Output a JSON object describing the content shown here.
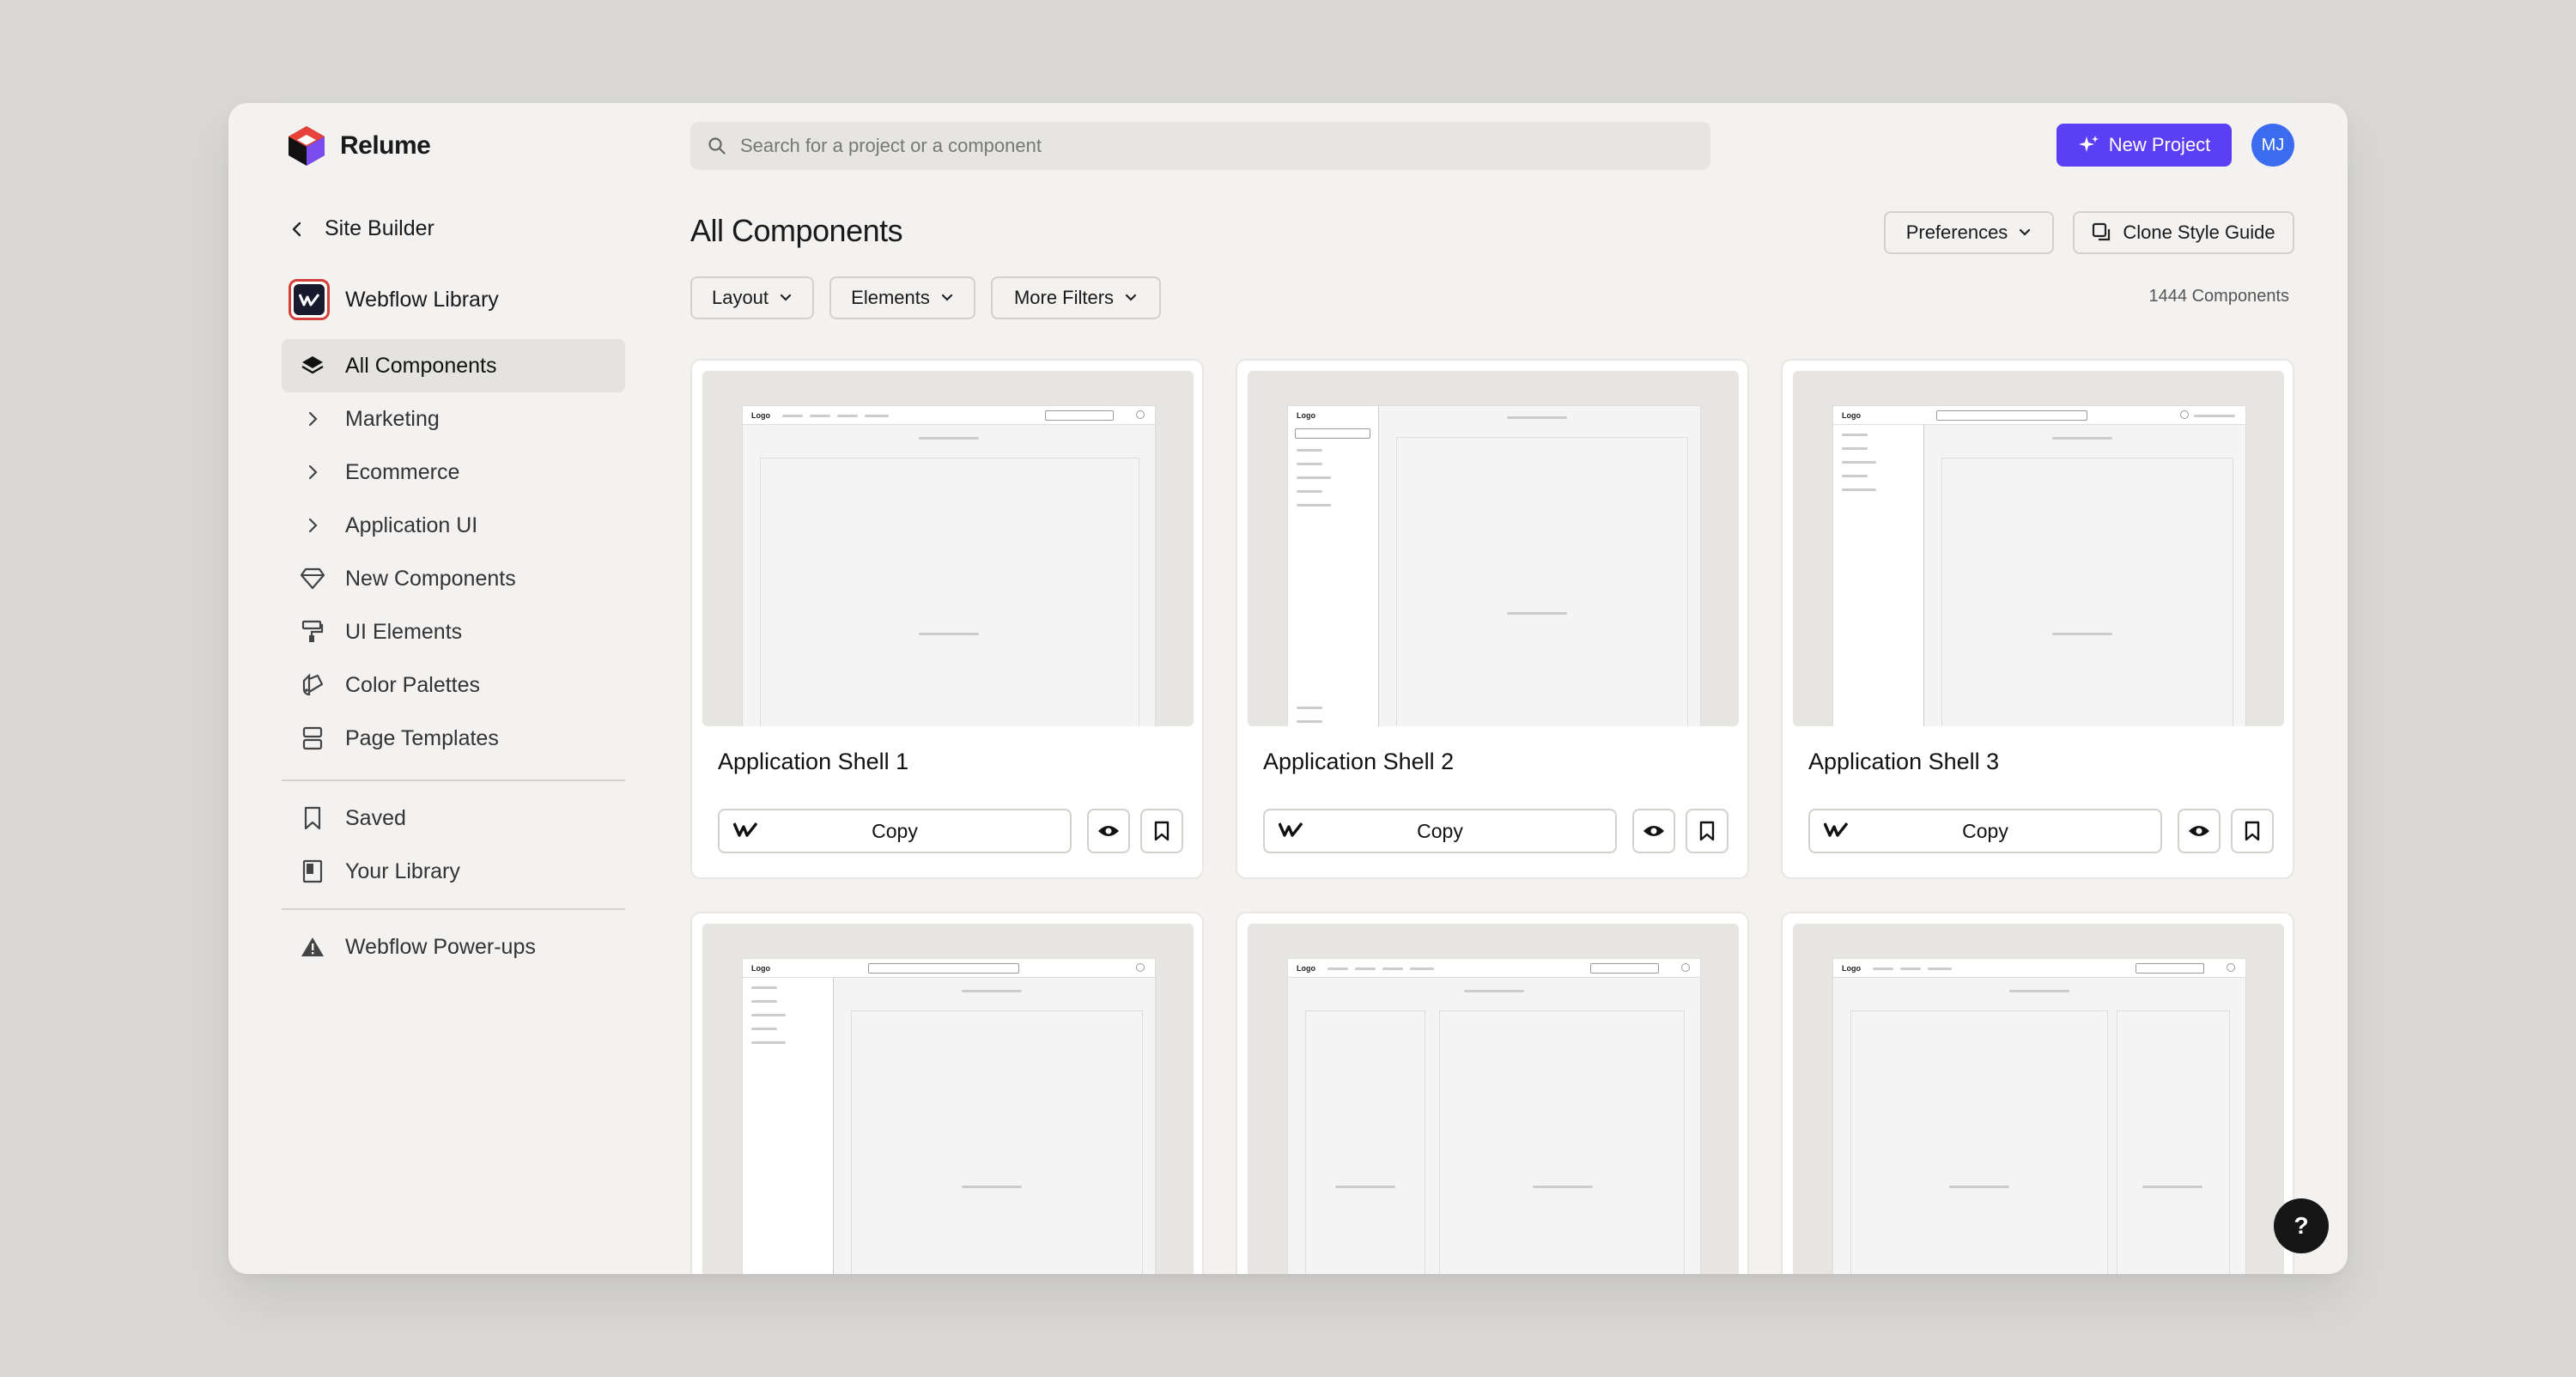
{
  "app": {
    "name": "Relume"
  },
  "search": {
    "placeholder": "Search for a project or a component"
  },
  "header": {
    "new_project_label": "New Project",
    "avatar_initials": "MJ"
  },
  "sidebar": {
    "back_label": "Site Builder",
    "library_name": "Webflow Library",
    "items": [
      {
        "label": "All Components",
        "icon": "layers-icon"
      },
      {
        "label": "Marketing",
        "icon": "chevron-right-icon"
      },
      {
        "label": "Ecommerce",
        "icon": "chevron-right-icon"
      },
      {
        "label": "Application UI",
        "icon": "chevron-right-icon"
      },
      {
        "label": "New Components",
        "icon": "diamond-icon"
      },
      {
        "label": "UI Elements",
        "icon": "paint-roller-icon"
      },
      {
        "label": "Color Palettes",
        "icon": "swatch-icon"
      },
      {
        "label": "Page Templates",
        "icon": "template-icon"
      }
    ],
    "secondary": [
      {
        "label": "Saved",
        "icon": "bookmark-icon"
      },
      {
        "label": "Your Library",
        "icon": "library-icon"
      }
    ],
    "tertiary": [
      {
        "label": "Webflow Power-ups",
        "icon": "triangle-icon"
      }
    ]
  },
  "main": {
    "title": "All Components",
    "preferences_label": "Preferences",
    "clone_label": "Clone Style Guide",
    "filters": [
      "Layout",
      "Elements",
      "More Filters"
    ],
    "count_label": "1444 Components",
    "copy_label": "Copy",
    "cards": [
      {
        "title": "Application Shell 1"
      },
      {
        "title": "Application Shell 2"
      },
      {
        "title": "Application Shell 3"
      }
    ]
  },
  "help_label": "?",
  "colors": {
    "accent": "#5b3ff5",
    "avatar": "#3b6cf0",
    "background": "#d9d8d4",
    "surface": "#f3f2f0"
  }
}
